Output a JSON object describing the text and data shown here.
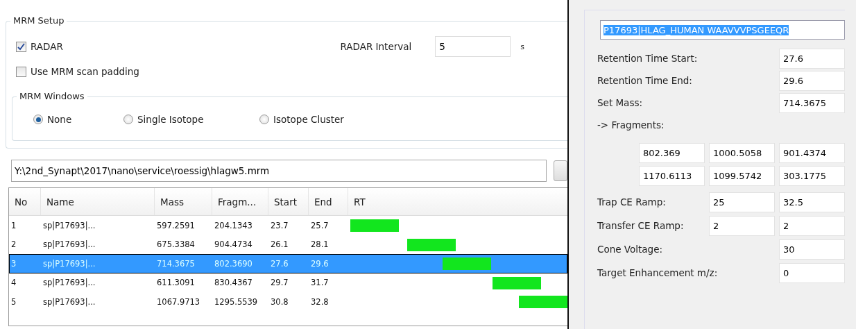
{
  "mrm_setup": {
    "title": "MRM Setup",
    "radar": {
      "label": "RADAR",
      "checked": true
    },
    "radar_interval": {
      "label": "RADAR Interval",
      "value": "5",
      "unit": "s"
    },
    "scan_padding": {
      "label": "Use MRM scan padding",
      "checked": false
    },
    "mrm_windows": {
      "title": "MRM Windows",
      "options": [
        {
          "label": "None",
          "selected": true
        },
        {
          "label": "Single Isotope",
          "selected": false
        },
        {
          "label": "Isotope Cluster",
          "selected": false
        }
      ]
    },
    "file_path": {
      "value": "Y:\\2nd_Synapt\\2017\\nano\\service\\roessig\\hlagw5.mrm"
    }
  },
  "table": {
    "columns": [
      "No",
      "Name",
      "Mass",
      "Fragm...",
      "Start",
      "End",
      "RT"
    ],
    "rows": [
      {
        "no": "1",
        "name": "sp|P17693|...",
        "mass": "597.2591",
        "fragment": "204.1343",
        "start": "23.7",
        "end": "25.7",
        "selected": false
      },
      {
        "no": "2",
        "name": "sp|P17693|...",
        "mass": "675.3384",
        "fragment": "904.4734",
        "start": "26.1",
        "end": "28.1",
        "selected": false
      },
      {
        "no": "3",
        "name": "sp|P17693|...",
        "mass": "714.3675",
        "fragment": "802.3690",
        "start": "27.6",
        "end": "29.6",
        "selected": true
      },
      {
        "no": "4",
        "name": "sp|P17693|...",
        "mass": "611.3091",
        "fragment": "830.4367",
        "start": "29.7",
        "end": "31.7",
        "selected": false
      },
      {
        "no": "5",
        "name": "sp|P17693|...",
        "mass": "1067.9713",
        "fragment": "1295.5539",
        "start": "30.8",
        "end": "32.8",
        "selected": false
      }
    ]
  },
  "details": {
    "title_field": "P17693|HLAG_HUMAN WAAVVVPSGEEQR",
    "rt_start": {
      "label": "Retention Time Start:",
      "value": "27.6"
    },
    "rt_end": {
      "label": "Retention Time End:",
      "value": "29.6"
    },
    "set_mass": {
      "label": "Set Mass:",
      "value": "714.3675"
    },
    "fragments_label": "-> Fragments:",
    "fragments": [
      [
        "802.369",
        "1000.5058",
        "901.4374"
      ],
      [
        "1170.6113",
        "1099.5742",
        "303.1775"
      ]
    ],
    "trap_ce": {
      "label": "Trap CE Ramp:",
      "values": [
        "25",
        "32.5"
      ]
    },
    "transfer_ce": {
      "label": "Transfer CE Ramp:",
      "values": [
        "2",
        "2"
      ]
    },
    "cone_voltage": {
      "label": "Cone Voltage:",
      "value": "30"
    },
    "target_enhancement": {
      "label": "Target Enhancement m/z:",
      "value": "0"
    }
  }
}
